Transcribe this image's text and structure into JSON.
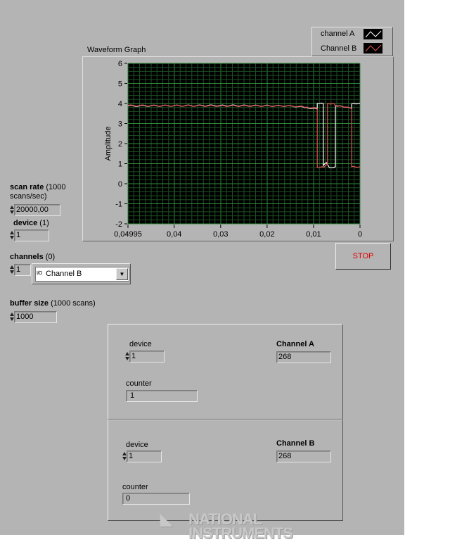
{
  "graph": {
    "title": "Waveform Graph",
    "legend": [
      {
        "name": "channel A",
        "color": "#ffffff"
      },
      {
        "name": "Channel B",
        "color": "#e05050"
      }
    ]
  },
  "stop_label": "STOP",
  "scan_rate": {
    "label_bold": "scan rate",
    "label_rest": " (1000",
    "label_line2": "scans/sec)",
    "value": "20000,00"
  },
  "device": {
    "label_bold": "device",
    "label_rest": " (1)",
    "value": "1"
  },
  "channels": {
    "label_bold": "channels",
    "label_rest": " (0)",
    "index": "1",
    "io_glyph": "I/O",
    "selected": "Channel B"
  },
  "buffer": {
    "label_bold": "buffer size",
    "label_rest": " (1000 scans)",
    "value": "1000"
  },
  "groupA": {
    "device_label": "device",
    "device_value": "1",
    "counter_label": "counter",
    "counter_value": "1",
    "channel_label": "Channel A",
    "channel_value": "268"
  },
  "groupB": {
    "device_label": "device",
    "device_value": "1",
    "counter_label": "counter",
    "counter_value": "0",
    "channel_label": "Channel B",
    "channel_value": "268"
  },
  "logo": "NATIONAL INSTRUMENTS",
  "chart_data": {
    "type": "line",
    "title": "Waveform Graph",
    "xlabel": "",
    "ylabel": "Amplitude",
    "xlim": [
      0.04995,
      0
    ],
    "ylim": [
      -2,
      6
    ],
    "xticks": [
      "0,04995",
      "0,04",
      "0,03",
      "0,02",
      "0,01",
      "0"
    ],
    "xtick_values": [
      0.04995,
      0.04,
      0.03,
      0.02,
      0.01,
      0
    ],
    "yticks": [
      "6",
      "5",
      "4",
      "3",
      "2",
      "1",
      "0",
      "-1",
      "-2"
    ],
    "ytick_values": [
      6,
      5,
      4,
      3,
      2,
      1,
      0,
      -1,
      -2
    ],
    "grid": true,
    "legend_position": "top-right",
    "series": [
      {
        "name": "channel A",
        "color": "#ffffff",
        "points": [
          [
            0.04995,
            3.88
          ],
          [
            0.03,
            3.9
          ],
          [
            0.015,
            3.88
          ],
          [
            0.0115,
            3.8
          ],
          [
            0.0092,
            3.72
          ],
          [
            0.0092,
            4.0
          ],
          [
            0.0079,
            4.0
          ],
          [
            0.0079,
            0.9
          ],
          [
            0.0072,
            1.05
          ],
          [
            0.0066,
            0.8
          ],
          [
            0.0053,
            0.85
          ],
          [
            0.0053,
            3.9
          ],
          [
            0.0035,
            3.82
          ],
          [
            0.0018,
            3.75
          ],
          [
            0.0018,
            3.98
          ],
          [
            0,
            4.02
          ]
        ]
      },
      {
        "name": "Channel B",
        "color": "#e05050",
        "points": [
          [
            0.04995,
            3.9
          ],
          [
            0.03,
            3.88
          ],
          [
            0.015,
            3.88
          ],
          [
            0.0115,
            3.82
          ],
          [
            0.0092,
            3.75
          ],
          [
            0.0092,
            0.8
          ],
          [
            0.0078,
            0.82
          ],
          [
            0.0072,
            0.95
          ],
          [
            0.007,
            0.95
          ],
          [
            0.007,
            4.0
          ],
          [
            0.0056,
            4.0
          ],
          [
            0.0053,
            3.88
          ],
          [
            0.0035,
            3.82
          ],
          [
            0.0018,
            3.76
          ],
          [
            0.0018,
            0.85
          ],
          [
            0,
            0.85
          ]
        ]
      }
    ]
  }
}
